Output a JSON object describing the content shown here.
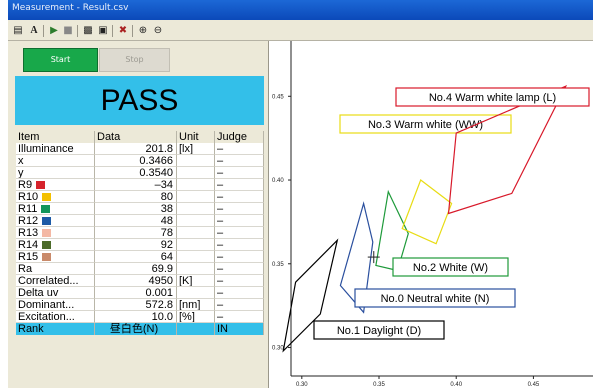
{
  "window": {
    "title": "Measurement - Result.csv"
  },
  "toolbar": {
    "icons": [
      "list-icon",
      "font-icon",
      "play-icon",
      "stop-icon",
      "print-icon",
      "lock-icon",
      "settings-icon",
      "zoom-in-icon",
      "zoom-out-icon"
    ]
  },
  "controls": {
    "start_label": "Start",
    "stop_label": "Stop"
  },
  "result": {
    "status": "PASS",
    "color": "#33bfe9"
  },
  "table": {
    "headers": [
      "Item",
      "Data",
      "Unit",
      "Judge"
    ],
    "rows": [
      {
        "item": "Illuminance",
        "data": "201.8",
        "unit": "[lx]",
        "judge": "–"
      },
      {
        "item": "x",
        "data": "0.3466",
        "unit": "",
        "judge": "–"
      },
      {
        "item": "y",
        "data": "0.3540",
        "unit": "",
        "judge": "–"
      },
      {
        "item": "R9",
        "data": "–34",
        "unit": "",
        "judge": "–",
        "swatch": "#d6232c"
      },
      {
        "item": "R10",
        "data": "80",
        "unit": "",
        "judge": "–",
        "swatch": "#f3c000"
      },
      {
        "item": "R11",
        "data": "38",
        "unit": "",
        "judge": "–",
        "swatch": "#13965a"
      },
      {
        "item": "R12",
        "data": "48",
        "unit": "",
        "judge": "–",
        "swatch": "#1d5aa6"
      },
      {
        "item": "R13",
        "data": "78",
        "unit": "",
        "judge": "–",
        "swatch": "#f4b8a4"
      },
      {
        "item": "R14",
        "data": "92",
        "unit": "",
        "judge": "–",
        "swatch": "#4c6b2a"
      },
      {
        "item": "R15",
        "data": "64",
        "unit": "",
        "judge": "–",
        "swatch": "#c98a6a"
      },
      {
        "item": "Ra",
        "data": "69.9",
        "unit": "",
        "judge": "–"
      },
      {
        "item": "Correlated...",
        "data": "4950",
        "unit": "[K]",
        "judge": "–"
      },
      {
        "item": "Delta uv",
        "data": "0.001",
        "unit": "",
        "judge": "–"
      },
      {
        "item": "Dominant...",
        "data": "572.8",
        "unit": "[nm]",
        "judge": "–"
      },
      {
        "item": "Excitation...",
        "data": "10.0",
        "unit": "[%]",
        "judge": "–"
      }
    ],
    "rank": {
      "item": "Rank",
      "data": "昼白色(N)",
      "unit": "",
      "judge": "IN"
    }
  },
  "chart_data": {
    "type": "scatter",
    "x_ticks": [
      "0.30",
      "0.35",
      "0.40",
      "0.45"
    ],
    "y_ticks": [
      "0.45",
      "0.40",
      "0.35",
      "0.30"
    ],
    "xlim": [
      0.293,
      0.486
    ],
    "ylim": [
      0.283,
      0.483
    ],
    "grid": false,
    "measured_point": {
      "x": 0.3466,
      "y": 0.354
    },
    "regions": [
      {
        "label": "No.1 Daylight (D)",
        "color": "#000000",
        "points": [
          [
            0.296,
            0.339
          ],
          [
            0.323,
            0.364
          ],
          [
            0.312,
            0.32
          ],
          [
            0.288,
            0.298
          ]
        ]
      },
      {
        "label": "No.0 Neutral white (N)",
        "color": "#2a4f9e",
        "points": [
          [
            0.34,
            0.386
          ],
          [
            0.346,
            0.363
          ],
          [
            0.34,
            0.321
          ],
          [
            0.325,
            0.337
          ]
        ]
      },
      {
        "label": "No.2 White (W)",
        "color": "#1e9a3a",
        "points": [
          [
            0.356,
            0.393
          ],
          [
            0.369,
            0.368
          ],
          [
            0.362,
            0.346
          ],
          [
            0.348,
            0.349
          ]
        ]
      },
      {
        "label": "No.3 Warm white (WW)",
        "color": "#e8dc14",
        "points": [
          [
            0.377,
            0.4
          ],
          [
            0.397,
            0.386
          ],
          [
            0.387,
            0.362
          ],
          [
            0.365,
            0.371
          ]
        ]
      },
      {
        "label": "No.4 Warm white lamp (L)",
        "color": "#d8192a",
        "points": [
          [
            0.4,
            0.428
          ],
          [
            0.471,
            0.456
          ],
          [
            0.436,
            0.392
          ],
          [
            0.395,
            0.38
          ]
        ]
      }
    ]
  }
}
